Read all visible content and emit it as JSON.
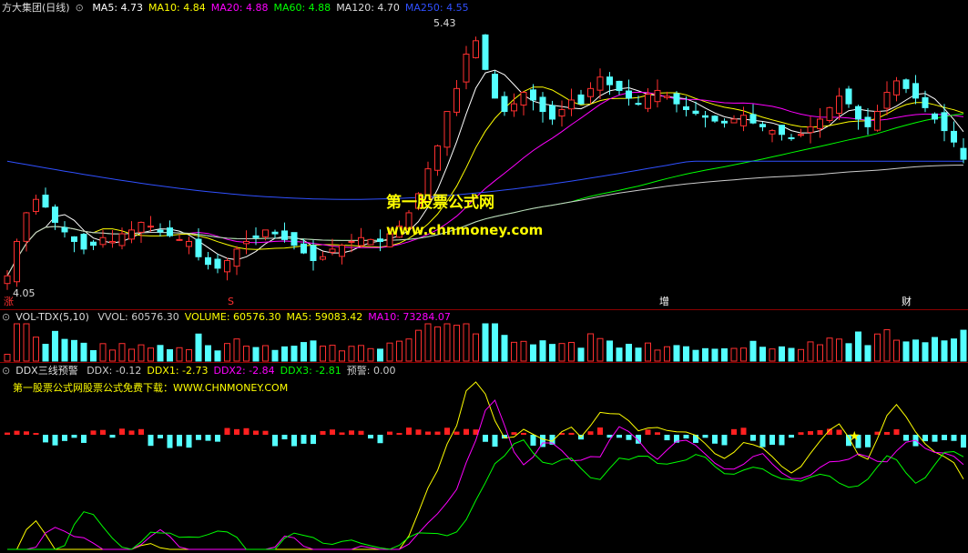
{
  "main_panel": {
    "title": "方大集团(日线)",
    "indicators": [
      {
        "label": "MA5: 4.73",
        "color": "#ffffff"
      },
      {
        "label": "MA10: 4.84",
        "color": "#ffff00"
      },
      {
        "label": "MA20: 4.88",
        "color": "#ff00ff"
      },
      {
        "label": "MA60: 4.88",
        "color": "#00ff00"
      },
      {
        "label": "MA120: 4.70",
        "color": "#dddddd"
      },
      {
        "label": "MA250: 4.55",
        "color": "#3050ff"
      }
    ],
    "high_label": "5.43",
    "low_label": "4.05",
    "markers": [
      {
        "text": "涨",
        "color": "#ff3030"
      },
      {
        "text": "S",
        "color": "#ff3030"
      },
      {
        "text": "增",
        "color": "#ffffff"
      },
      {
        "text": "财",
        "color": "#ffffff"
      }
    ],
    "watermark_cn": "第一股票公式网",
    "watermark_url": "www.chnmoney.com"
  },
  "volume_panel": {
    "title": "VOL-TDX(5,10)",
    "indicators": [
      {
        "label": "VVOL: 60576.30",
        "color": "#cccccc"
      },
      {
        "label": "VOLUME: 60576.30",
        "color": "#ffff00"
      },
      {
        "label": "MA5: 59083.42",
        "color": "#ffff00"
      },
      {
        "label": "MA10: 73284.07",
        "color": "#ff00ff"
      }
    ]
  },
  "ddx_panel": {
    "title": "DDX三线预警",
    "indicators": [
      {
        "label": "DDX: -0.12",
        "color": "#cccccc"
      },
      {
        "label": "DDX1: -2.73",
        "color": "#ffff00"
      },
      {
        "label": "DDX2: -2.84",
        "color": "#ff00ff"
      },
      {
        "label": "DDX3: -2.81",
        "color": "#00ff00"
      },
      {
        "label": "预警: 0.00",
        "color": "#cccccc"
      }
    ],
    "note": "第一股票公式网股票公式免费下载：WWW.CHNMONEY.COM"
  },
  "chart_data": {
    "type": "candlestick",
    "price_range": [
      4.05,
      5.43
    ],
    "closes": [
      4.12,
      4.3,
      4.45,
      4.52,
      4.48,
      4.4,
      4.35,
      4.3,
      4.26,
      4.28,
      4.32,
      4.3,
      4.34,
      4.36,
      4.4,
      4.38,
      4.35,
      4.33,
      4.31,
      4.3,
      4.22,
      4.18,
      4.16,
      4.2,
      4.26,
      4.3,
      4.32,
      4.36,
      4.34,
      4.31,
      4.28,
      4.24,
      4.2,
      4.22,
      4.26,
      4.28,
      4.3,
      4.32,
      4.31,
      4.3,
      4.34,
      4.38,
      4.45,
      4.55,
      4.68,
      4.8,
      4.98,
      5.1,
      5.28,
      5.35,
      5.2,
      5.05,
      4.98,
      5.02,
      5.08,
      5.04,
      4.98,
      4.94,
      4.99,
      5.04,
      5.02,
      5.1,
      5.16,
      5.12,
      5.09,
      5.05,
      5.02,
      5.07,
      5.09,
      5.06,
      5.02,
      4.99,
      4.97,
      4.95,
      4.93,
      4.92,
      4.94,
      4.96,
      4.92,
      4.9,
      4.88,
      4.86,
      4.84,
      4.86,
      4.9,
      4.94,
      5.0,
      5.06,
      5.02,
      4.94,
      4.9,
      4.98,
      5.08,
      5.14,
      5.1,
      5.05,
      5.0,
      4.94,
      4.88,
      4.82,
      4.73
    ],
    "volume_scale": "relative",
    "ddx_series": [
      "DDX1",
      "DDX2",
      "DDX3"
    ]
  }
}
